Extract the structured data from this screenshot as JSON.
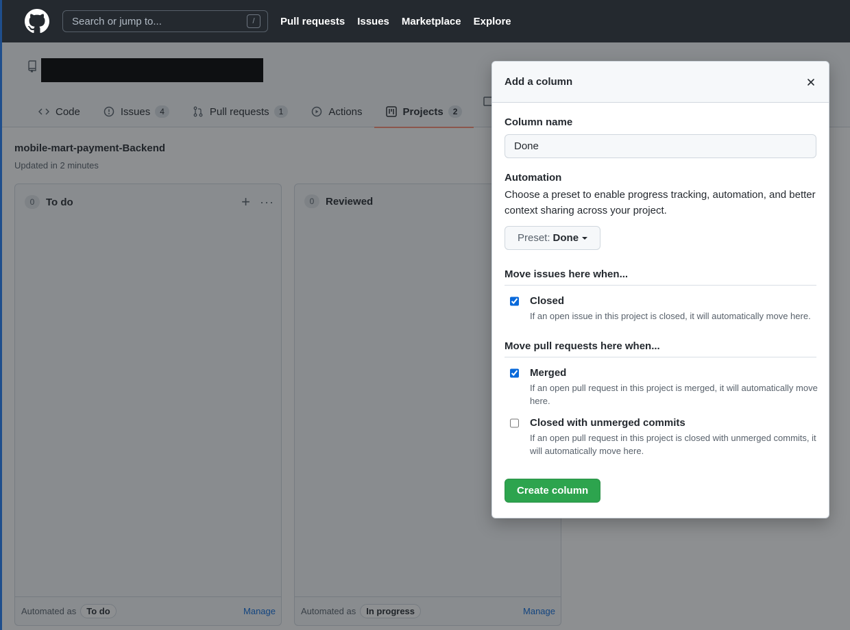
{
  "header": {
    "search_placeholder": "Search or jump to...",
    "search_shortcut": "/",
    "nav": [
      "Pull requests",
      "Issues",
      "Marketplace",
      "Explore"
    ]
  },
  "repo": {
    "tabs": [
      {
        "label": "Code",
        "icon": "code-icon",
        "count": null
      },
      {
        "label": "Issues",
        "icon": "issue-icon",
        "count": "4"
      },
      {
        "label": "Pull requests",
        "icon": "pull-request-icon",
        "count": "1"
      },
      {
        "label": "Actions",
        "icon": "play-icon",
        "count": null
      },
      {
        "label": "Projects",
        "icon": "project-icon",
        "count": "2",
        "selected": true
      }
    ]
  },
  "project": {
    "title": "mobile-mart-payment-Backend",
    "updated": "Updated in 2 minutes",
    "columns": [
      {
        "count": "0",
        "name": "To do",
        "automated_label": "Automated as",
        "automated_value": "To do",
        "manage": "Manage"
      },
      {
        "count": "0",
        "name": "Reviewed",
        "automated_label": "Automated as",
        "automated_value": "In progress",
        "manage": "Manage"
      }
    ]
  },
  "dialog": {
    "title": "Add a column",
    "column_name_label": "Column name",
    "column_name_value": "Done",
    "automation_label": "Automation",
    "automation_desc": "Choose a preset to enable progress tracking, automation, and better context sharing across your project.",
    "preset_label": "Preset:",
    "preset_value": "Done",
    "issues_section": "Move issues here when...",
    "issues_options": [
      {
        "name": "Closed",
        "desc": "If an open issue in this project is closed, it will automatically move here.",
        "checked": true
      }
    ],
    "pr_section": "Move pull requests here when...",
    "pr_options": [
      {
        "name": "Merged",
        "desc": "If an open pull request in this project is merged, it will automatically move here.",
        "checked": true
      },
      {
        "name": "Closed with unmerged commits",
        "desc": "If an open pull request in this project is closed with unmerged commits, it will automatically move here.",
        "checked": false
      }
    ],
    "create_button": "Create column"
  },
  "colors": {
    "header_bg": "#24292f",
    "accent_green": "#2da44e",
    "link_blue": "#0969da",
    "tab_underline": "#fd8c73"
  }
}
